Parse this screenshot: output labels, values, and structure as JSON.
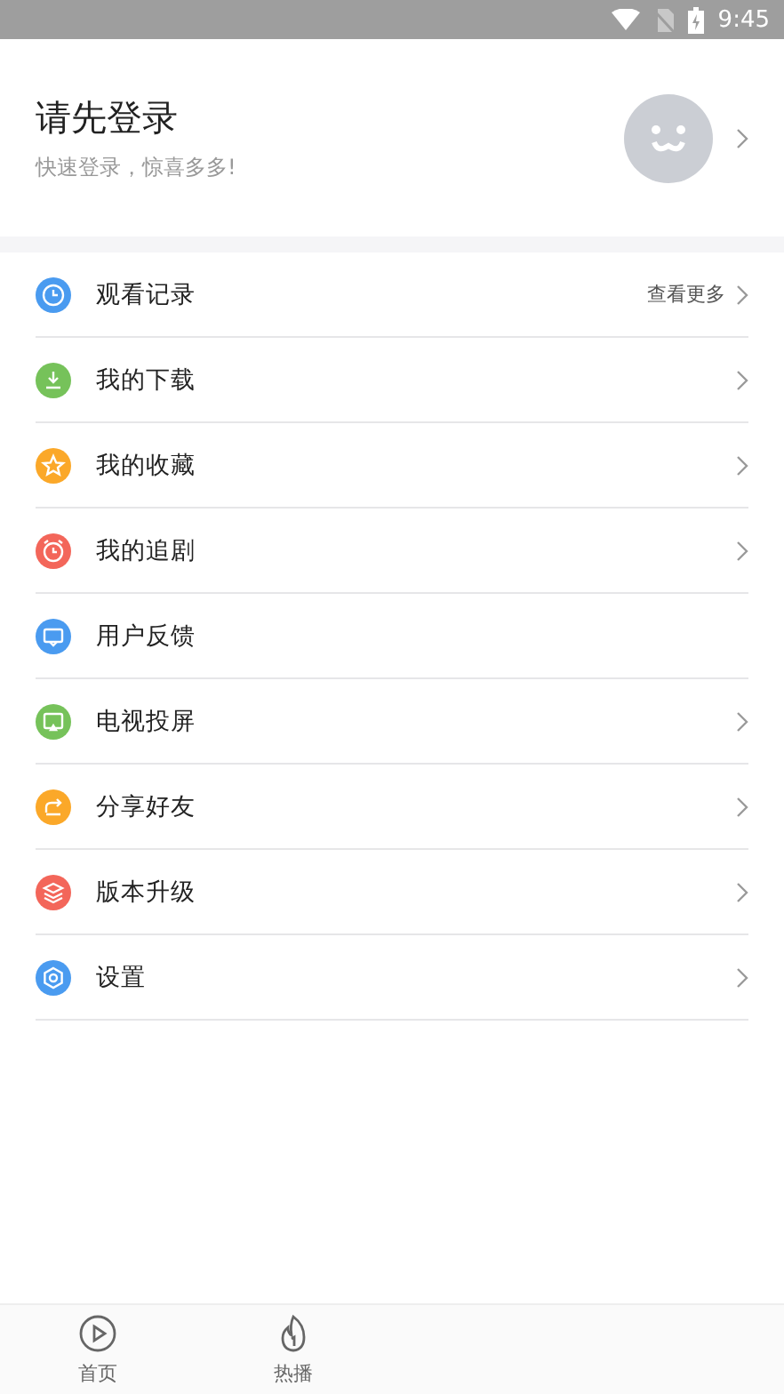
{
  "status_bar": {
    "time": "9:45"
  },
  "profile": {
    "title": "请先登录",
    "subtitle": "快速登录，惊喜多多!"
  },
  "menu": [
    {
      "label": "观看记录",
      "kind": "clock",
      "color": "#4a9bf0",
      "extra": "查看更多",
      "chevron": true
    },
    {
      "label": "我的下载",
      "kind": "download",
      "color": "#76c25a",
      "chevron": true
    },
    {
      "label": "我的收藏",
      "kind": "star",
      "color": "#fba829",
      "chevron": true
    },
    {
      "label": "我的追剧",
      "kind": "alarm",
      "color": "#f3665a",
      "chevron": true
    },
    {
      "label": "用户反馈",
      "kind": "message",
      "color": "#4a9bf0",
      "chevron": false
    },
    {
      "label": "电视投屏",
      "kind": "tv",
      "color": "#76c25a",
      "chevron": true
    },
    {
      "label": "分享好友",
      "kind": "share",
      "color": "#fba829",
      "chevron": true
    },
    {
      "label": "版本升级",
      "kind": "layers",
      "color": "#f3665a",
      "chevron": true
    },
    {
      "label": "设置",
      "kind": "gear",
      "color": "#4a9bf0",
      "chevron": true
    }
  ],
  "tab_bar": [
    {
      "label": "首页",
      "selected": false
    },
    {
      "label": "热播",
      "selected": false
    }
  ]
}
